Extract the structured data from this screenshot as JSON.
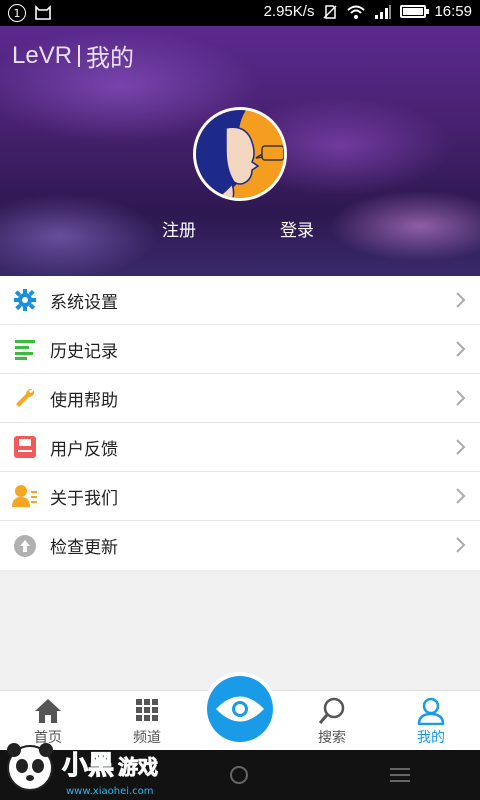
{
  "status_bar": {
    "notification_count": "1",
    "network_speed": "2.95K/s",
    "time": "16:59"
  },
  "header": {
    "brand": "LeVR",
    "page_title": "我的",
    "register_label": "注册",
    "login_label": "登录"
  },
  "menu": {
    "items": [
      {
        "label": "系统设置",
        "icon": "gear-icon",
        "color": "#1a8fe0"
      },
      {
        "label": "历史记录",
        "icon": "list-icon",
        "color": "#3cbc3c"
      },
      {
        "label": "使用帮助",
        "icon": "wrench-icon",
        "color": "#f5a623"
      },
      {
        "label": "用户反馈",
        "icon": "feedback-icon",
        "color": "#f05a5a"
      },
      {
        "label": "关于我们",
        "icon": "about-icon",
        "color": "#f5a623"
      },
      {
        "label": "检查更新",
        "icon": "update-icon",
        "color": "#b0b0b0"
      }
    ]
  },
  "bottom_nav": {
    "tabs": [
      {
        "label": "首页",
        "icon": "home-icon"
      },
      {
        "label": "频道",
        "icon": "grid-icon"
      },
      {
        "label": "",
        "icon": "eye-icon"
      },
      {
        "label": "搜索",
        "icon": "search-icon"
      },
      {
        "label": "我的",
        "icon": "user-icon",
        "active": true
      }
    ]
  },
  "watermark": {
    "text": "小黑游戏",
    "url": "www.xiaohei.com"
  },
  "colors": {
    "accent": "#1a9be8"
  }
}
